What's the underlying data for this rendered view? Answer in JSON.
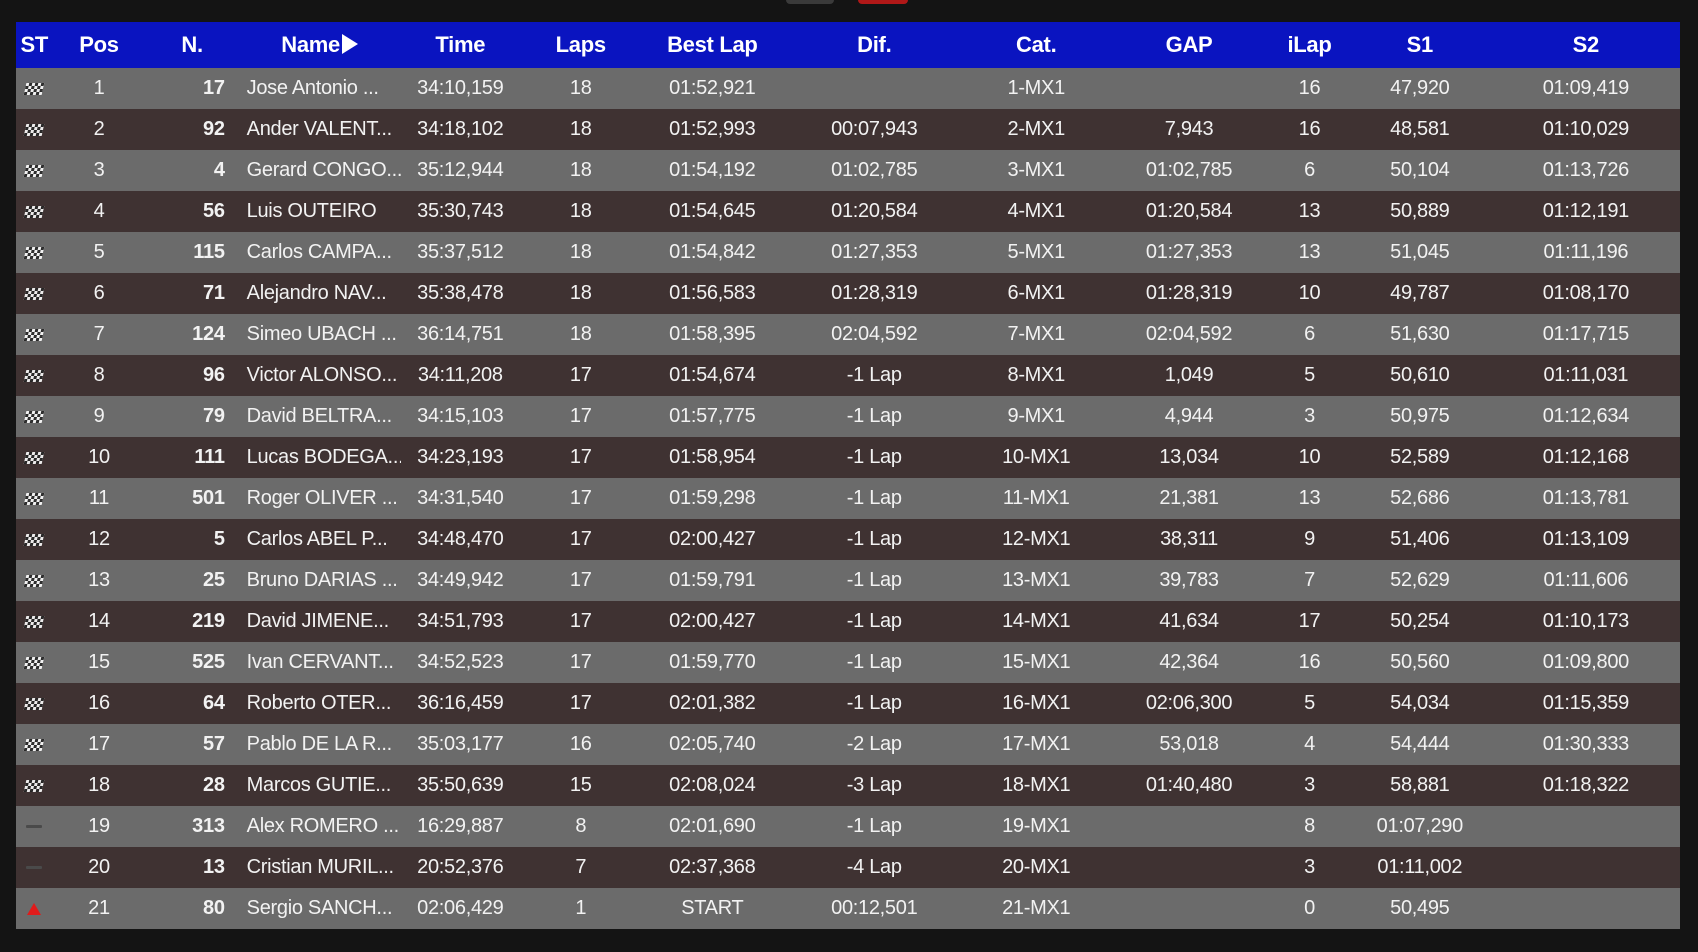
{
  "colors": {
    "header_bg": "#0a14c0",
    "row_light": "#6b6b6b",
    "row_dark": "#3f3232",
    "page_bg": "#141414",
    "up_marker": "#e01b1b"
  },
  "columns": {
    "st": "ST",
    "pos": "Pos",
    "num": "N.",
    "name": "Name",
    "time": "Time",
    "laps": "Laps",
    "best_lap": "Best Lap",
    "dif": "Dif.",
    "cat": "Cat.",
    "gap": "GAP",
    "ilap": "iLap",
    "s1": "S1",
    "s2": "S2"
  },
  "rows": [
    {
      "st_icon": "checkered-flag-icon",
      "pos": "1",
      "num": "17",
      "name": "Jose Antonio ...",
      "time": "34:10,159",
      "laps": "18",
      "best_lap": "01:52,921",
      "dif": "",
      "cat": "1-MX1",
      "gap": "",
      "ilap": "16",
      "s1": "47,920",
      "s2": "01:09,419"
    },
    {
      "st_icon": "checkered-flag-icon",
      "pos": "2",
      "num": "92",
      "name": "Ander VALENT...",
      "time": "34:18,102",
      "laps": "18",
      "best_lap": "01:52,993",
      "dif": "00:07,943",
      "cat": "2-MX1",
      "gap": "7,943",
      "ilap": "16",
      "s1": "48,581",
      "s2": "01:10,029"
    },
    {
      "st_icon": "checkered-flag-icon",
      "pos": "3",
      "num": "4",
      "name": "Gerard CONGO...",
      "time": "35:12,944",
      "laps": "18",
      "best_lap": "01:54,192",
      "dif": "01:02,785",
      "cat": "3-MX1",
      "gap": "01:02,785",
      "ilap": "6",
      "s1": "50,104",
      "s2": "01:13,726"
    },
    {
      "st_icon": "checkered-flag-icon",
      "pos": "4",
      "num": "56",
      "name": "Luis OUTEIRO",
      "time": "35:30,743",
      "laps": "18",
      "best_lap": "01:54,645",
      "dif": "01:20,584",
      "cat": "4-MX1",
      "gap": "01:20,584",
      "ilap": "13",
      "s1": "50,889",
      "s2": "01:12,191"
    },
    {
      "st_icon": "checkered-flag-icon",
      "pos": "5",
      "num": "115",
      "name": "Carlos CAMPA...",
      "time": "35:37,512",
      "laps": "18",
      "best_lap": "01:54,842",
      "dif": "01:27,353",
      "cat": "5-MX1",
      "gap": "01:27,353",
      "ilap": "13",
      "s1": "51,045",
      "s2": "01:11,196"
    },
    {
      "st_icon": "checkered-flag-icon",
      "pos": "6",
      "num": "71",
      "name": "Alejandro NAV...",
      "time": "35:38,478",
      "laps": "18",
      "best_lap": "01:56,583",
      "dif": "01:28,319",
      "cat": "6-MX1",
      "gap": "01:28,319",
      "ilap": "10",
      "s1": "49,787",
      "s2": "01:08,170"
    },
    {
      "st_icon": "checkered-flag-icon",
      "pos": "7",
      "num": "124",
      "name": "Simeo UBACH ...",
      "time": "36:14,751",
      "laps": "18",
      "best_lap": "01:58,395",
      "dif": "02:04,592",
      "cat": "7-MX1",
      "gap": "02:04,592",
      "ilap": "6",
      "s1": "51,630",
      "s2": "01:17,715"
    },
    {
      "st_icon": "checkered-flag-icon",
      "pos": "8",
      "num": "96",
      "name": "Victor ALONSO...",
      "time": "34:11,208",
      "laps": "17",
      "best_lap": "01:54,674",
      "dif": "-1 Lap",
      "cat": "8-MX1",
      "gap": "1,049",
      "ilap": "5",
      "s1": "50,610",
      "s2": "01:11,031"
    },
    {
      "st_icon": "checkered-flag-icon",
      "pos": "9",
      "num": "79",
      "name": "David BELTRA...",
      "time": "34:15,103",
      "laps": "17",
      "best_lap": "01:57,775",
      "dif": "-1 Lap",
      "cat": "9-MX1",
      "gap": "4,944",
      "ilap": "3",
      "s1": "50,975",
      "s2": "01:12,634"
    },
    {
      "st_icon": "checkered-flag-icon",
      "pos": "10",
      "num": "111",
      "name": "Lucas BODEGA...",
      "time": "34:23,193",
      "laps": "17",
      "best_lap": "01:58,954",
      "dif": "-1 Lap",
      "cat": "10-MX1",
      "gap": "13,034",
      "ilap": "10",
      "s1": "52,589",
      "s2": "01:12,168"
    },
    {
      "st_icon": "checkered-flag-icon",
      "pos": "11",
      "num": "501",
      "name": "Roger OLIVER ...",
      "time": "34:31,540",
      "laps": "17",
      "best_lap": "01:59,298",
      "dif": "-1 Lap",
      "cat": "11-MX1",
      "gap": "21,381",
      "ilap": "13",
      "s1": "52,686",
      "s2": "01:13,781"
    },
    {
      "st_icon": "checkered-flag-icon",
      "pos": "12",
      "num": "5",
      "name": "Carlos ABEL P...",
      "time": "34:48,470",
      "laps": "17",
      "best_lap": "02:00,427",
      "dif": "-1 Lap",
      "cat": "12-MX1",
      "gap": "38,311",
      "ilap": "9",
      "s1": "51,406",
      "s2": "01:13,109"
    },
    {
      "st_icon": "checkered-flag-icon",
      "pos": "13",
      "num": "25",
      "name": "Bruno DARIAS ...",
      "time": "34:49,942",
      "laps": "17",
      "best_lap": "01:59,791",
      "dif": "-1 Lap",
      "cat": "13-MX1",
      "gap": "39,783",
      "ilap": "7",
      "s1": "52,629",
      "s2": "01:11,606"
    },
    {
      "st_icon": "checkered-flag-icon",
      "pos": "14",
      "num": "219",
      "name": "David JIMENE...",
      "time": "34:51,793",
      "laps": "17",
      "best_lap": "02:00,427",
      "dif": "-1 Lap",
      "cat": "14-MX1",
      "gap": "41,634",
      "ilap": "17",
      "s1": "50,254",
      "s2": "01:10,173"
    },
    {
      "st_icon": "checkered-flag-icon",
      "pos": "15",
      "num": "525",
      "name": "Ivan CERVANT...",
      "time": "34:52,523",
      "laps": "17",
      "best_lap": "01:59,770",
      "dif": "-1 Lap",
      "cat": "15-MX1",
      "gap": "42,364",
      "ilap": "16",
      "s1": "50,560",
      "s2": "01:09,800"
    },
    {
      "st_icon": "checkered-flag-icon",
      "pos": "16",
      "num": "64",
      "name": "Roberto OTER...",
      "time": "36:16,459",
      "laps": "17",
      "best_lap": "02:01,382",
      "dif": "-1 Lap",
      "cat": "16-MX1",
      "gap": "02:06,300",
      "ilap": "5",
      "s1": "54,034",
      "s2": "01:15,359"
    },
    {
      "st_icon": "checkered-flag-icon",
      "pos": "17",
      "num": "57",
      "name": "Pablo DE LA R...",
      "time": "35:03,177",
      "laps": "16",
      "best_lap": "02:05,740",
      "dif": "-2 Lap",
      "cat": "17-MX1",
      "gap": "53,018",
      "ilap": "4",
      "s1": "54,444",
      "s2": "01:30,333"
    },
    {
      "st_icon": "checkered-flag-icon",
      "pos": "18",
      "num": "28",
      "name": "Marcos GUTIE...",
      "time": "35:50,639",
      "laps": "15",
      "best_lap": "02:08,024",
      "dif": "-3 Lap",
      "cat": "18-MX1",
      "gap": "01:40,480",
      "ilap": "3",
      "s1": "58,881",
      "s2": "01:18,322"
    },
    {
      "st_icon": "dash-icon",
      "pos": "19",
      "num": "313",
      "name": "Alex ROMERO ...",
      "time": "16:29,887",
      "laps": "8",
      "best_lap": "02:01,690",
      "dif": "-1 Lap",
      "cat": "19-MX1",
      "gap": "",
      "ilap": "8",
      "s1": "01:07,290",
      "s2": ""
    },
    {
      "st_icon": "dash-icon",
      "pos": "20",
      "num": "13",
      "name": "Cristian MURIL...",
      "time": "20:52,376",
      "laps": "7",
      "best_lap": "02:37,368",
      "dif": "-4 Lap",
      "cat": "20-MX1",
      "gap": "",
      "ilap": "3",
      "s1": "01:11,002",
      "s2": ""
    },
    {
      "st_icon": "up-arrow-icon",
      "pos": "21",
      "num": "80",
      "name": "Sergio SANCH...",
      "time": "02:06,429",
      "laps": "1",
      "best_lap": "START",
      "dif": "00:12,501",
      "cat": "21-MX1",
      "gap": "",
      "ilap": "0",
      "s1": "50,495",
      "s2": ""
    }
  ]
}
